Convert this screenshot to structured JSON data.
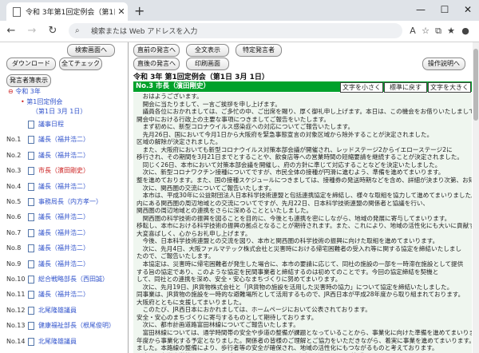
{
  "browser": {
    "tab_title": "令和 3年第1回定例会（第1日 3月",
    "url_placeholder": "検索または Web アドレスを入力",
    "new_tab": "+",
    "win_min": "—",
    "win_max": "☐",
    "win_close": "✕",
    "tab_close": "✕"
  },
  "left": {
    "btn_search_screen": "検索画面へ",
    "btn_download": "ダウンロード",
    "btn_check_all": "全てチェック",
    "btn_speaker_display": "発言者簿表示",
    "tree_root": "令和 3年",
    "tree_session": "第1回定例会",
    "tree_day": "（第1日 3月 1日）",
    "rows": [
      {
        "no": "",
        "label": "議事日程",
        "red": false
      },
      {
        "no": "No.1",
        "label": "議長（福井浩二）",
        "red": false
      },
      {
        "no": "No.2",
        "label": "議長（福井浩二）",
        "red": false
      },
      {
        "no": "No.3",
        "label": "市長（濱田剛史）",
        "red": true
      },
      {
        "no": "No.4",
        "label": "議長（福井浩二）",
        "red": false
      },
      {
        "no": "No.5",
        "label": "事務局長（内方孝一）",
        "red": false
      },
      {
        "no": "No.6",
        "label": "議長（福井浩二）",
        "red": false
      },
      {
        "no": "No.7",
        "label": "議長（福井浩二）",
        "red": false
      },
      {
        "no": "No.8",
        "label": "議長（福井浩二）",
        "red": false
      },
      {
        "no": "No.9",
        "label": "議長（福井浩二）",
        "red": false
      },
      {
        "no": "No.10",
        "label": "総合戦略部長（西田誠）",
        "red": false
      },
      {
        "no": "No.11",
        "label": "議長（福井浩二）",
        "red": false
      },
      {
        "no": "No.12",
        "label": "北尾隆雄議員",
        "red": false
      },
      {
        "no": "No.13",
        "label": "健康福祉部長（根尾俊明）",
        "red": false
      },
      {
        "no": "No.14",
        "label": "北尾隆雄議員",
        "red": false
      },
      {
        "no": "No.15",
        "label": "健康福祉部長（根尾俊明）",
        "red": false
      }
    ]
  },
  "right": {
    "btn_prev": "直前の発言へ",
    "btn_all": "全文表示",
    "btn_specific": "特定発言者",
    "btn_next": "直後の発言へ",
    "btn_print": "印刷画面",
    "btn_help": "操作説明へ",
    "heading": "令和 3年 第1回定例会（第1日 3月 1日）",
    "speaker": "No.3 市長（濱田剛史）",
    "font_small": "文字を小さく",
    "font_reset": "標準に戻す",
    "font_large": "文字を大きく",
    "lines": [
      "　おはようございます。",
      "　開会に当たりまして、一言ご挨拶を申し上げます。",
      "　議員各位におかれましては、ご多忙の中、ご出席を賜り、厚く御礼申し上げます。本日は、この機会をお借りいたしまして、",
      "開会中における行政上の主要な事項につきましてご報告をいたします。",
      "　まず初めに、新型コロナウイルス感染症への対応についてご報告いたします。",
      "　先月26日、国において今月1日から大阪府を緊急事態宣言の対象区域から除外することが決定されました。",
      "区域の解除が決定されました。",
      "　また、大阪府においても新型コロナウイルス対策本部会議が開催され、レッドステージ2からイエローステージ2に",
      "移行され、その期間を3月21日までとすることや、飲食店等への営業時間の短縮要請を継続することが決定されました。",
      "　同じく26日、本市において対策本部会議を開催し、府の方針に準じて対応することなどを決定いたしました。",
      "　次に、新型コロナワクチン接種についてですが、市民全体の接種が円滑に進むよう、準備を進めてまいります。",
      "整を進めております。また、国の接種スケジュールにつきましては、接種券の発送時期などを含め、詳細が決まり次第、お知らせしてまいります。",
      "　次に、関西圏の交流についてご報告いたします。",
      "　本市は、平成30年に公益財団法人日本科学技術連盟と包括連携協定を締結し、様々な取組を協力して進めてまいりました。",
      "内にある関西圏の周辺地域との交流についてですが、先月22日、日本科学技術連盟の関係者と協議を行い、",
      "関西圏の周辺地域との連携をさらに深めることといたしました。",
      "　関西圏の科学技術の振興を図ることを目的に、今後とも連携を密にしながら、地域の発展に寄与してまいります。",
      "移転し、本市における科学技術の振興の拠点となることが期待されます。また、これにより、地域の活性化にも大いに貢献するものと考えております。",
      "大変喜ばしく、心からお礼申し上げます。",
      "　今後、日本科学技術連盟との交流を図り、本市と関西圏の科学技術の振興に向けた取組を進めてまいります。",
      "　次に、先月4日、大阪ファルマテック株式会社と災害時における帰宅困難者の受入れ等に関する協定を締結いたしまし",
      "たので、ご報告いたします。",
      "　本協定は、災害時に帰宅困難者が発生した場合に、本市の要請に応じて、同社の施設の一部を一時滞在施設として提供",
      "する旨の協定であり、このような協定を民間事業者と締結するのは初めてのことです。今回の協定締結を契機と",
      "して、同社との連携を深め、安全・安心なまちづくりに努めてまいります。",
      "　次に、先月19日、JR貨物株式会社と「JR貨物の施設を活用した災害時の協力」について協定を締結いたしました。",
      "同事業は、JR貨物の施設を一時的な避難場所として活用するもので、JR西日本が平成28年度から取り組まれております。",
      "大阪府とともに支援してまいりました。",
      "　このたび、JR西日本におかれましては、ホームページにおいて公表されております。",
      "安全・安心のまちづくりに寄与するものとして期待しております。",
      "　次に、都市計画道路富田林線についてご報告いたします。",
      "　富田林線については、通学時間帯の安全や歩道の整備が課題となっていることから、事業化に向けた準備を進めてまいりました。",
      "年度から事業化する予定となりました。関係者の皆様のご理解とご協力をいただきながら、着実に事業を進めてまいります。",
      "ました。本路線の整備により、歩行者等の安全が確保され、地域の活性化にもつながるものと考えております。",
      "　次に、寿栄小学校のセーフティプロモーションスクールの認証取得についてご報告いたします。",
      "　寿栄小学校においては、令和元年9月に本市の学校安全推進モデル校に指定し、セーフティプロモーションスクール"
    ]
  }
}
